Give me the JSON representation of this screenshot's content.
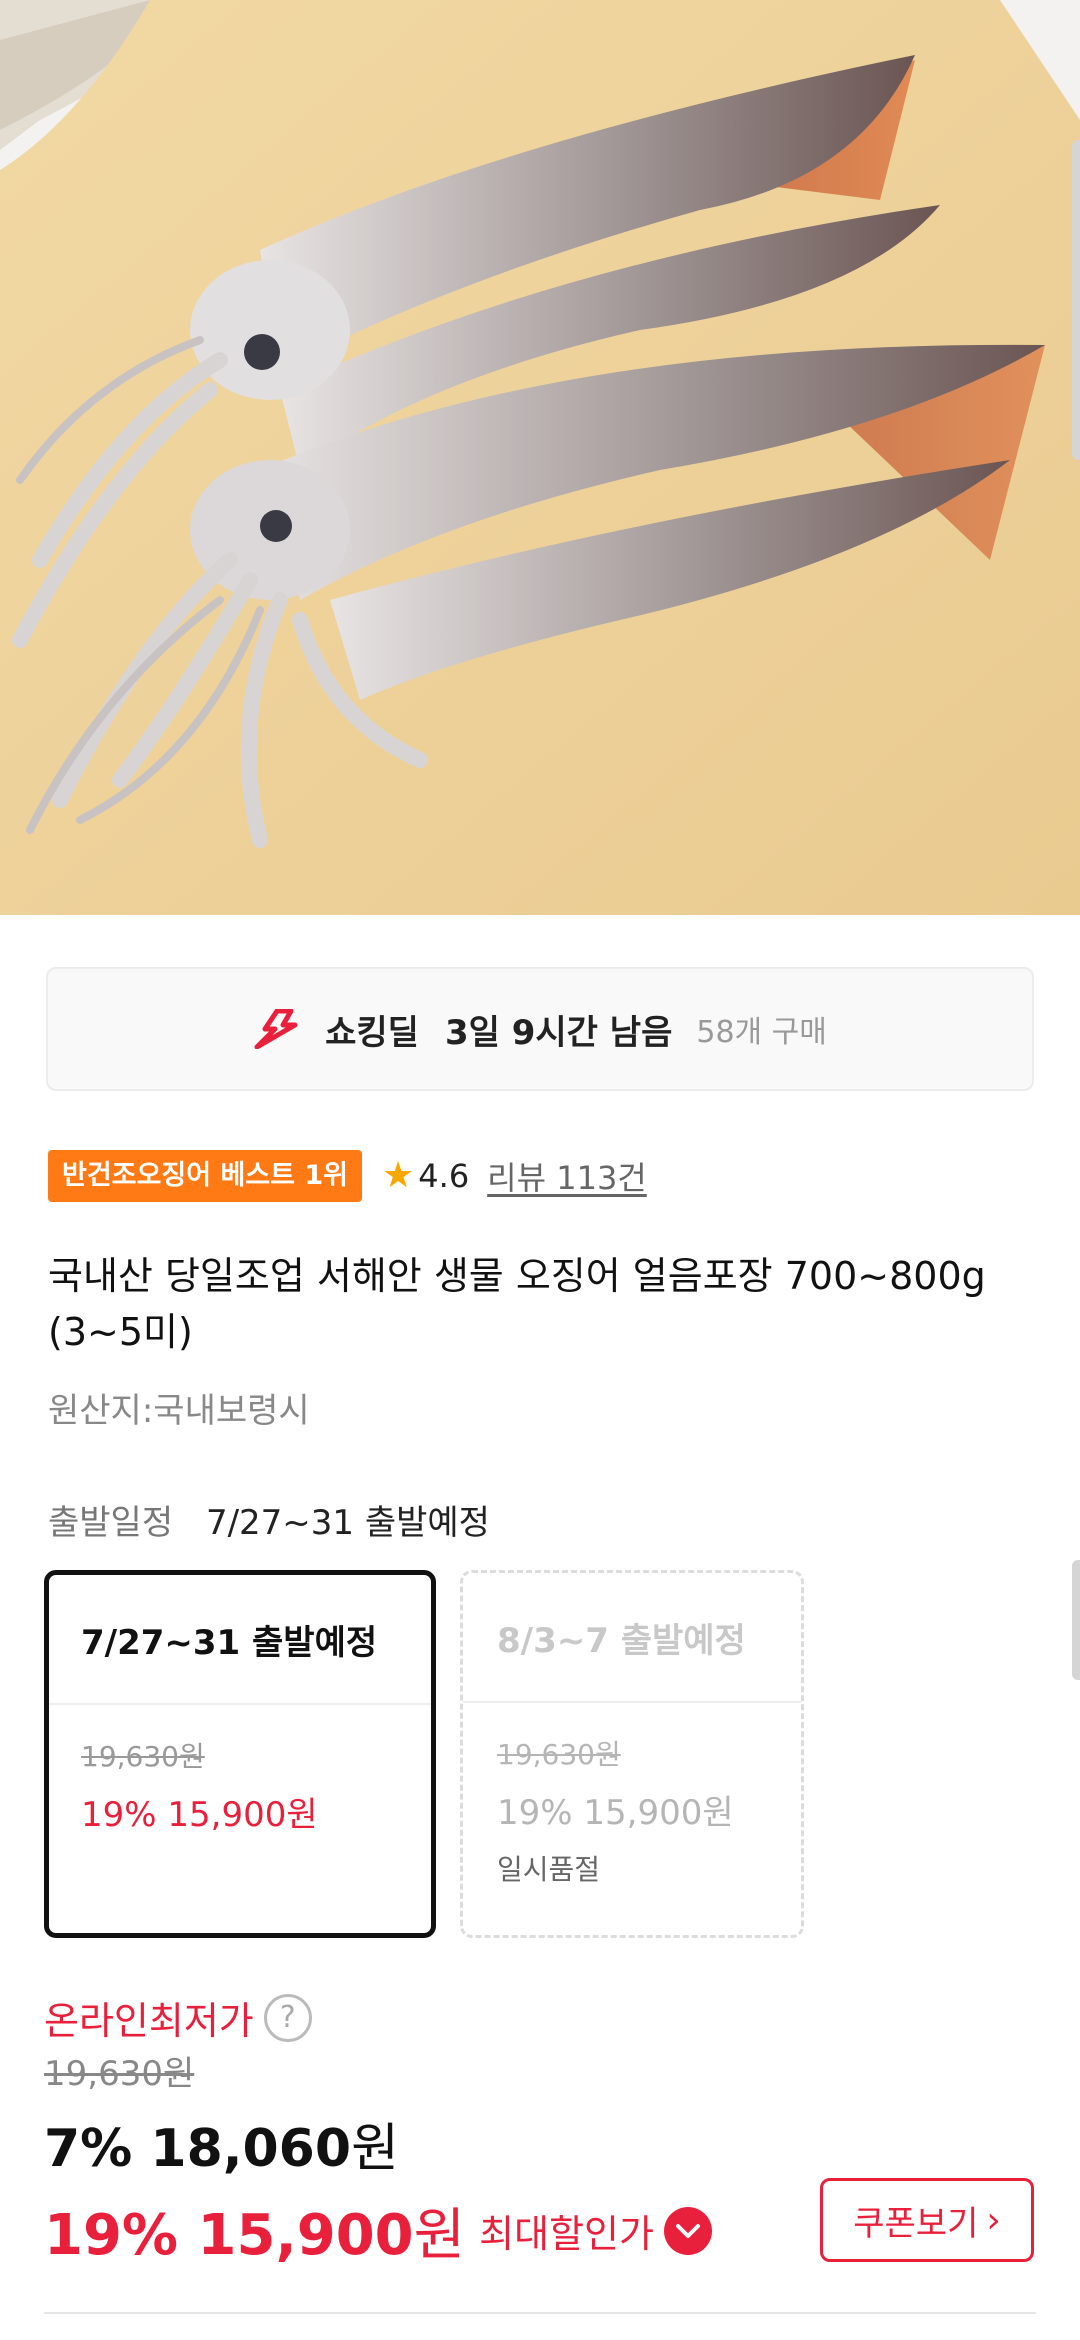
{
  "deal": {
    "icon": "shocking-deal-bolt-icon",
    "title": "쇼킹딜",
    "time_left": "3일 9시간 남음",
    "purchase_count": "58개 구매"
  },
  "badge": {
    "best_label": "반건조오징어 베스트 1위",
    "star_icon": "★",
    "rating": "4.6",
    "review_label": "리뷰 113건"
  },
  "product": {
    "title": "국내산 당일조업 서해안 생물 오징어 얼음포장 700~800g (3~5미)",
    "origin": "원산지:국내보령시"
  },
  "departure": {
    "label": "출발일정",
    "selected": "7/27~31 출발예정",
    "options": [
      {
        "title": "7/27~31 출발예정",
        "original_price": "19,630원",
        "sale": "19% 15,900원",
        "status": ""
      },
      {
        "title": "8/3~7 출발예정",
        "original_price": "19,630원",
        "sale": "19% 15,900원",
        "status": "일시품절"
      }
    ]
  },
  "price": {
    "lowest_label": "온라인최저가",
    "help_icon": "?",
    "original": "19,630원",
    "mid_percent_amount": "7% 18,060",
    "mid_unit": "원",
    "best_percent_amount": "19% 15,900",
    "best_unit": "원",
    "max_discount_label": "최대할인가",
    "coupon_label": "쿠폰보기",
    "coupon_chevron": "›"
  },
  "colors": {
    "accent_red": "#e8203c",
    "badge_orange": "#ff7a14",
    "star": "#f6a800"
  }
}
